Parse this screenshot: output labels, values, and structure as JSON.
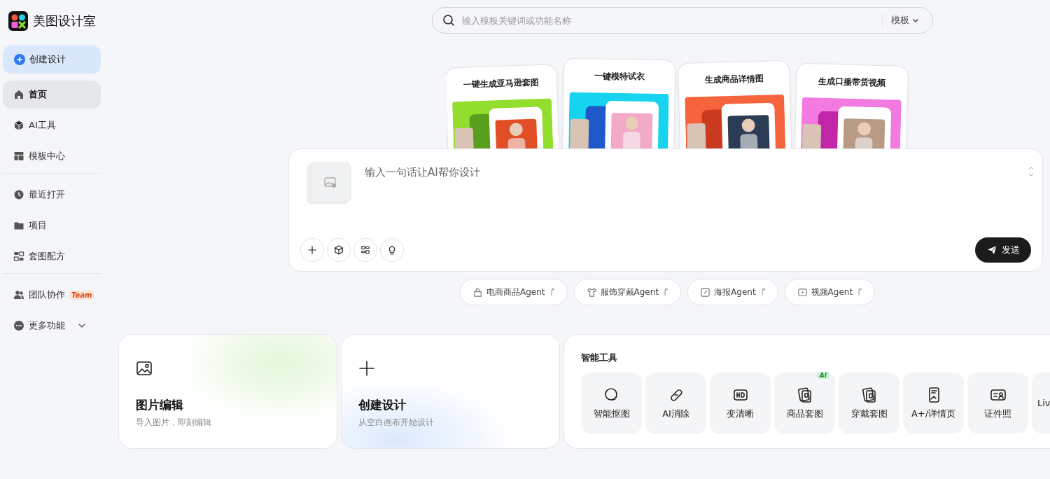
{
  "logo": {
    "text": "美图设计室"
  },
  "sidebar": {
    "create_button": "创建设计",
    "sections": [
      [
        {
          "label": "首页",
          "selected": true
        },
        {
          "label": "AI工具",
          "selected": false
        },
        {
          "label": "模板中心",
          "selected": false
        }
      ],
      [
        {
          "label": "最近打开",
          "selected": false
        },
        {
          "label": "项目",
          "selected": false
        },
        {
          "label": "套图配方",
          "selected": false
        }
      ],
      [
        {
          "label": "团队协作",
          "selected": false,
          "badge": "Team"
        },
        {
          "label": "更多功能",
          "selected": false,
          "expanded": false
        }
      ]
    ]
  },
  "search": {
    "placeholder": "输入模板关键词或功能名称",
    "scope": "模板"
  },
  "showcase": [
    {
      "title": "一键生成亚马逊套图",
      "kind": "picture"
    },
    {
      "title": "一键模特试衣",
      "kind": "picture"
    },
    {
      "title": "生成商品详情图",
      "kind": "picture"
    },
    {
      "title": "生成口播带货视频",
      "kind": "picture"
    }
  ],
  "prompt": {
    "placeholder": "输入一句话让AI帮你设计",
    "send_button": "发送"
  },
  "agents": [
    {
      "label": "电商商品Agent"
    },
    {
      "label": "服饰穿戴Agent"
    },
    {
      "label": "海报Agent"
    },
    {
      "label": "视频Agent"
    }
  ],
  "quick_actions": [
    {
      "title": "图片编辑",
      "subtitle": "导入图片，即刻编辑"
    },
    {
      "title": "创建设计",
      "subtitle": "从空白画布开始设计"
    }
  ],
  "smart_tools": {
    "title": "智能工具",
    "tools": [
      {
        "label": "智能抠图"
      },
      {
        "label": "AI消除"
      },
      {
        "label": "变清晰"
      },
      {
        "label": "商品套图",
        "badge": "AI"
      },
      {
        "label": "穿戴套图"
      },
      {
        "label": "A+/详情页"
      },
      {
        "label": "证件照"
      },
      {
        "label": "Liv"
      }
    ]
  }
}
